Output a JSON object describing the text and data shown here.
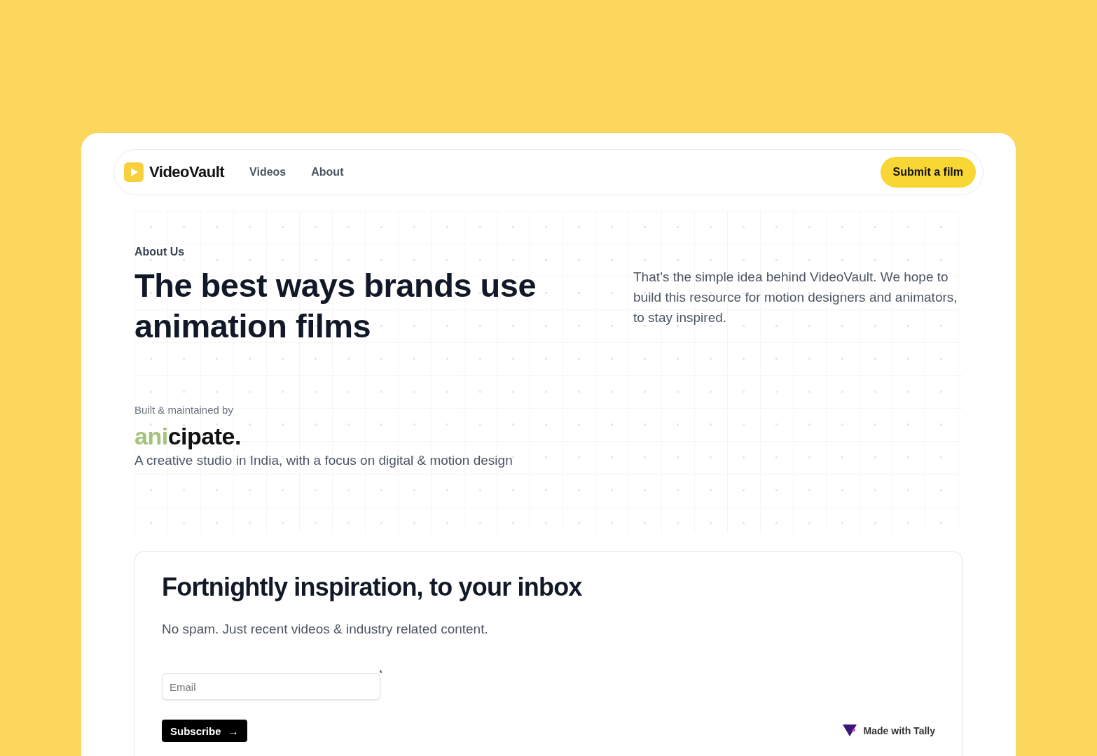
{
  "nav": {
    "brand": "VideoVault",
    "links": [
      {
        "label": "Videos"
      },
      {
        "label": "About"
      }
    ],
    "cta": "Submit a film"
  },
  "hero": {
    "eyebrow": "About Us",
    "title": "The best ways brands use animation films",
    "description": "That’s the simple idea behind VideoVault. We hope to build this resource for motion designers and animators, to stay inspired."
  },
  "credits": {
    "label": "Built & maintained by",
    "logo_accent": "ani",
    "logo_rest": "cipate.",
    "tagline": "A creative studio in India, with a focus on digital & motion design"
  },
  "newsletter": {
    "title": "Fortnightly inspiration, to your inbox",
    "subtitle": "No spam. Just recent videos & industry related content.",
    "email": {
      "placeholder": "Email",
      "required": true,
      "required_mark": "*"
    },
    "button": "Subscribe",
    "arrow": "→",
    "badge": "Made with Tally"
  }
}
